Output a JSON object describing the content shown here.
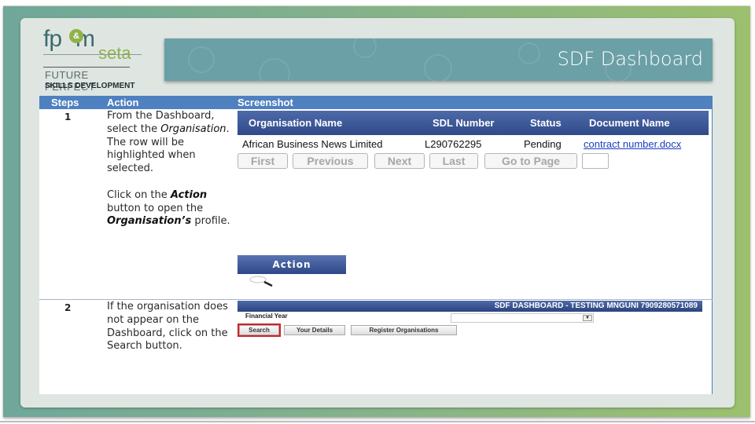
{
  "logo": {
    "brand": "fp",
    "brand_amp": "&",
    "brand_end": "m",
    "sub": "seta",
    "line1": "FUTURE PERFECT",
    "line2": "SKILLS DEVELOPMENT"
  },
  "banner": {
    "title": "SDF Dashboard"
  },
  "table": {
    "headers": {
      "steps": "Steps",
      "action": "Action",
      "screenshot": "Screenshot"
    },
    "steps": [
      {
        "number": "1",
        "paragraphs": [
          [
            "From the Dashboard, select the ",
            {
              "i": "Organisation"
            },
            ". The row will be highlighted when selected."
          ],
          [
            "Click on the ",
            {
              "bi": "Action"
            },
            " button to open the ",
            {
              "bi": "Organisation’s"
            },
            " profile."
          ]
        ]
      },
      {
        "number": "2",
        "paragraphs": [
          [
            "If the organisation does not appear on the Dashboard, click on the Search button."
          ]
        ]
      }
    ]
  },
  "screenshot1": {
    "columns": [
      "Organisation Name",
      "SDL Number",
      "Status",
      "Document Name"
    ],
    "rows": [
      {
        "organisation": "African Business News Limited",
        "sdl": "L290762295",
        "status": "Pending",
        "document": "contract number.docx"
      }
    ],
    "pager": [
      "First",
      "Previous",
      "Next",
      "Last",
      "Go to Page"
    ],
    "page_input_value": "",
    "action_label": "Action"
  },
  "screenshot2": {
    "header": "SDF DASHBOARD - TESTING MNGUNI 7909280571089",
    "financial_year_label": "Financial Year",
    "financial_year_value": "",
    "buttons": [
      "Search",
      "Your Details",
      "Register Organisations"
    ]
  },
  "colors": {
    "frame_start": "#6fa79a",
    "frame_end": "#9cc06e",
    "banner": "#6aa0a6",
    "table_header": "#4f80c0",
    "grid_header": "#2f4a8a",
    "link": "#1a3fbf",
    "highlight": "#d0202a"
  }
}
